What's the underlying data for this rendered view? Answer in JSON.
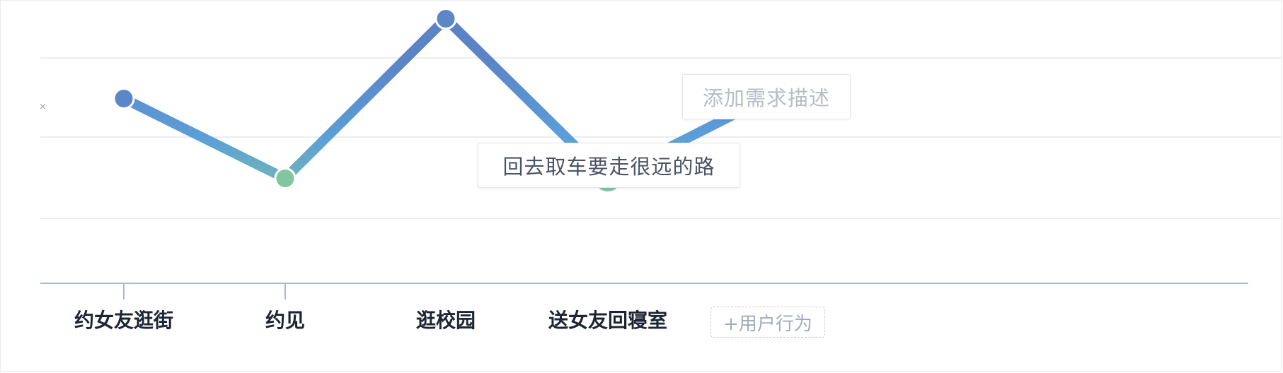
{
  "journey": {
    "steps": [
      {
        "label": "约女友逛街",
        "score": 3
      },
      {
        "label": "约见",
        "score": 1
      },
      {
        "label": "逛校园",
        "score": 5
      },
      {
        "label": "送女友回寝室",
        "score": 1
      },
      {
        "label": "",
        "score": 3
      }
    ],
    "add_step_label": "+用户行为",
    "description_placeholder": "添加需求描述",
    "pain_point_note": "回去取车要走很远的路",
    "close_glyph": "×"
  },
  "chart_data": {
    "type": "line",
    "categories": [
      "约女友逛街",
      "约见",
      "逛校园",
      "送女友回寝室",
      ""
    ],
    "values": [
      3,
      1,
      5,
      1,
      3
    ],
    "ylim": [
      0,
      5
    ],
    "grid": true,
    "colors": {
      "high": "#5b86c8",
      "mid": "#5c9ad6",
      "low": "#82c5a0",
      "axis": "#aeb8cc",
      "grid": "#ebedf2"
    }
  }
}
